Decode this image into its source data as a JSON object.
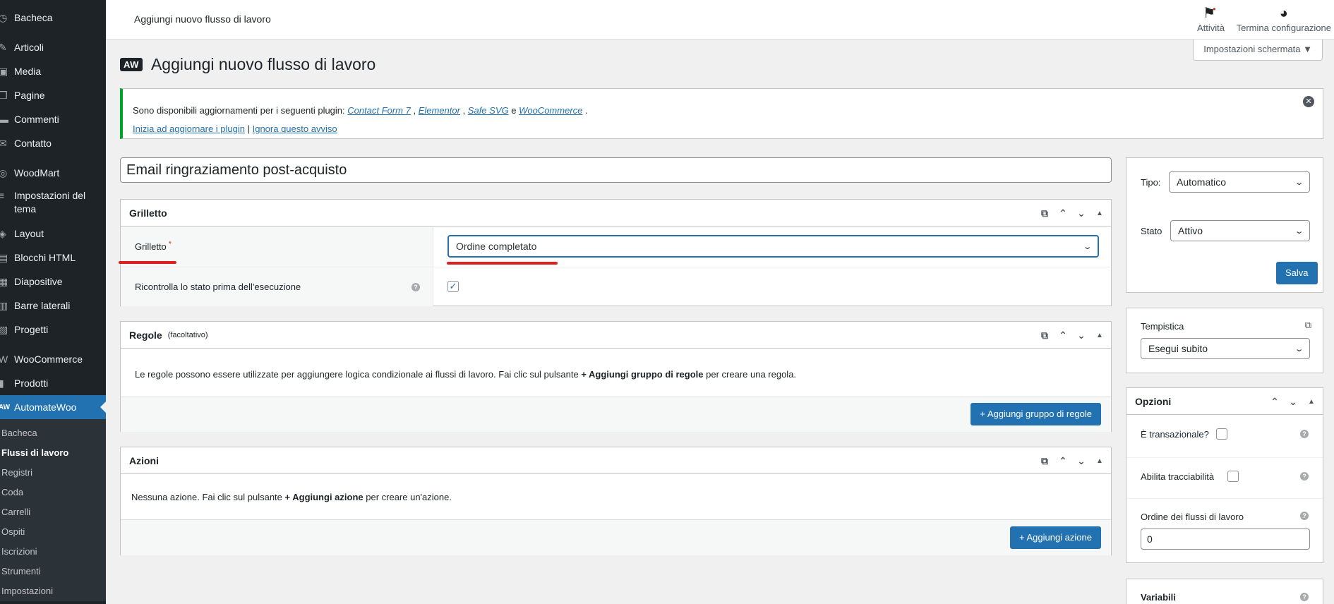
{
  "sidebar": {
    "items": [
      {
        "label": "Bacheca",
        "icon": "dashboard-icon",
        "glyph": "◷"
      },
      {
        "label": "Articoli",
        "icon": "pin-icon",
        "glyph": "✎"
      },
      {
        "label": "Media",
        "icon": "media-icon",
        "glyph": "▣"
      },
      {
        "label": "Pagine",
        "icon": "pages-icon",
        "glyph": "❒"
      },
      {
        "label": "Commenti",
        "icon": "comments-icon",
        "glyph": "▬"
      },
      {
        "label": "Contatto",
        "icon": "mail-icon",
        "glyph": "✉"
      },
      {
        "label": "WoodMart",
        "icon": "woodmart-icon",
        "glyph": "◎"
      },
      {
        "label": "Impostazioni del tema",
        "icon": "sliders-icon",
        "glyph": "≡"
      },
      {
        "label": "Layout",
        "icon": "layers-icon",
        "glyph": "◈"
      },
      {
        "label": "Blocchi HTML",
        "icon": "code-icon",
        "glyph": "▤"
      },
      {
        "label": "Diapositive",
        "icon": "slides-icon",
        "glyph": "▦"
      },
      {
        "label": "Barre laterali",
        "icon": "sidebar-icon",
        "glyph": "▥"
      },
      {
        "label": "Progetti",
        "icon": "portfolio-icon",
        "glyph": "▧"
      },
      {
        "label": "WooCommerce",
        "icon": "woo-icon",
        "glyph": "W"
      },
      {
        "label": "Prodotti",
        "icon": "products-icon",
        "glyph": "▮"
      },
      {
        "label": "AutomateWoo",
        "icon": "aw-icon",
        "glyph": "AW"
      }
    ],
    "submenu": [
      "Bacheca",
      "Flussi di lavoro",
      "Registri",
      "Coda",
      "Carrelli",
      "Ospiti",
      "Iscrizioni",
      "Strumenti",
      "Impostazioni"
    ]
  },
  "topbar": {
    "title": "Aggiungi nuovo flusso di lavoro",
    "activity": "Attività",
    "finish_setup": "Termina configurazione",
    "screen_options": "Impostazioni schermata ▼"
  },
  "page": {
    "logo": "AW",
    "heading": "Aggiungi nuovo flusso di lavoro"
  },
  "notice": {
    "text_before": "Sono disponibili aggiornamenti per i seguenti plugin: ",
    "plugins": [
      "Contact Form 7",
      "Elementor",
      "Safe SVG",
      "WooCommerce"
    ],
    "sep_comma": " , ",
    "sep_and": " e ",
    "end": " .",
    "update_link": "Inizia ad aggiornare i plugin",
    "pipe": " | ",
    "ignore_link": "Ignora questo avviso"
  },
  "workflow_title": "Email ringraziamento post-acquisto",
  "trigger_box": {
    "title": "Grilletto",
    "trigger_label": "Grilletto",
    "required_mark": "*",
    "trigger_value": "Ordine completato",
    "recheck_label": "Ricontrolla lo stato prima dell'esecuzione",
    "recheck_checked": true
  },
  "rules_box": {
    "title": "Regole",
    "optional": "(facoltativo)",
    "desc_before": "Le regole possono essere utilizzate per aggiungere logica condizionale ai flussi di lavoro. Fai clic sul pulsante ",
    "desc_bold": "+ Aggiungi gruppo di regole",
    "desc_after": " per creare una regola.",
    "button": "+ Aggiungi gruppo di regole"
  },
  "actions_box": {
    "title": "Azioni",
    "desc_before": "Nessuna azione. Fai clic sul pulsante ",
    "desc_bold": "+ Aggiungi azione",
    "desc_after": " per creare un'azione.",
    "button": "+ Aggiungi azione"
  },
  "publish_box": {
    "type_label": "Tipo:",
    "type_value": "Automatico",
    "status_label": "Stato",
    "status_value": "Attivo",
    "save_button": "Salva"
  },
  "timing_box": {
    "label": "Tempistica",
    "value": "Esegui subito"
  },
  "options_box": {
    "title": "Opzioni",
    "transactional_label": "È transazionale?",
    "tracking_label": "Abilita tracciabilità",
    "order_label": "Ordine dei flussi di lavoro",
    "order_value": "0"
  },
  "variables_box": {
    "title": "Variabili"
  },
  "colors": {
    "accent": "#2271b1",
    "sidebar": "#1d2327",
    "annotation": "#e0201f",
    "notice_border": "#00a32a"
  }
}
